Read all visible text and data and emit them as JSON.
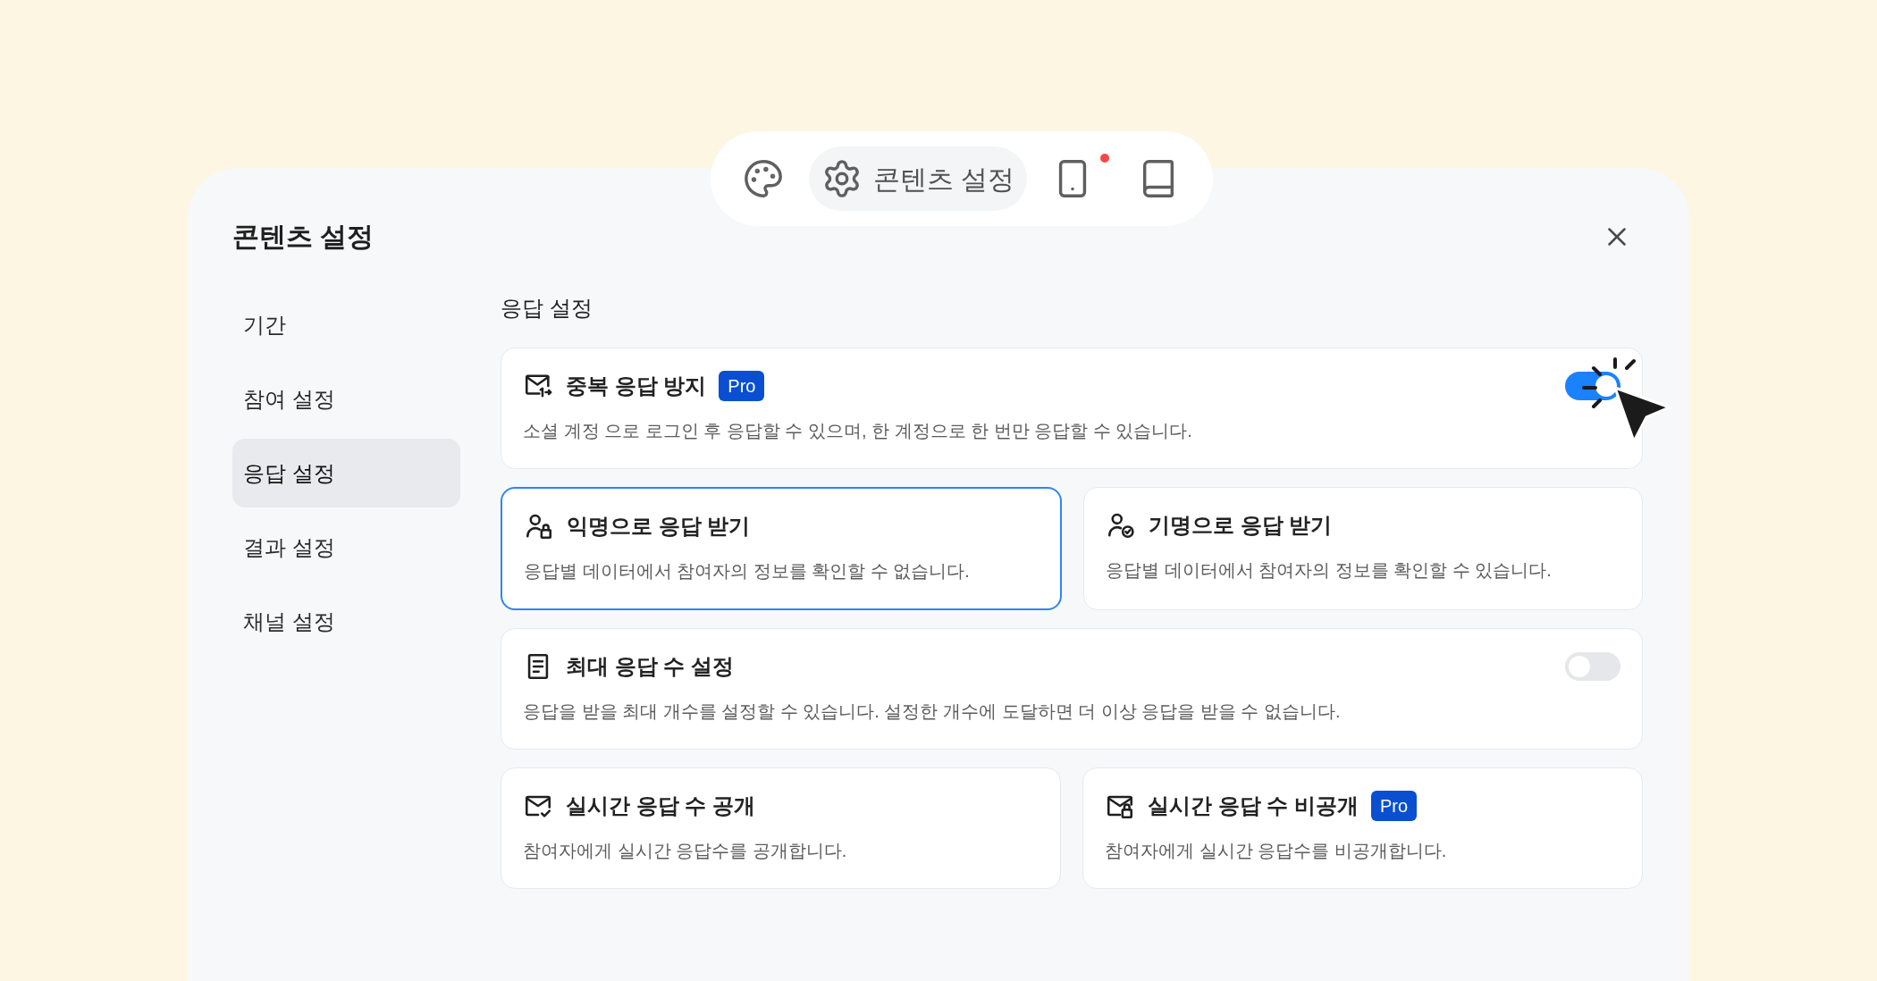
{
  "toolbar": {
    "items": [
      {
        "kind": "palette",
        "selected": false
      },
      {
        "kind": "settings",
        "label": "콘텐츠 설정",
        "selected": true
      },
      {
        "kind": "phone",
        "selected": false,
        "notification": true
      },
      {
        "kind": "book",
        "selected": false
      }
    ]
  },
  "panel": {
    "title": "콘텐츠 설정"
  },
  "sidebar": {
    "items": [
      {
        "label": "기간",
        "selected": false
      },
      {
        "label": "참여 설정",
        "selected": false
      },
      {
        "label": "응답 설정",
        "selected": true
      },
      {
        "label": "결과 설정",
        "selected": false
      },
      {
        "label": "채널 설정",
        "selected": false
      }
    ]
  },
  "section": {
    "title": "응답 설정",
    "rows": [
      {
        "cards": [
          {
            "kind": "mail-arrow",
            "title": "중복 응답 방지",
            "badge": "Pro",
            "description": "소셜 계정 으로 로그인 후 응답할 수 있으며, 한 계정으로 한 번만 응답할 수 있습니다.",
            "toggle": {
              "on": true
            }
          }
        ]
      },
      {
        "cards": [
          {
            "kind": "user-lock",
            "title": "익명으로 응답 받기",
            "description": "응답별 데이터에서 참여자의 정보를 확인할 수 없습니다.",
            "selected": true
          },
          {
            "kind": "user-check",
            "title": "기명으로 응답 받기",
            "description": "응답별 데이터에서 참여자의 정보를 확인할 수 있습니다.",
            "selected": false
          }
        ]
      },
      {
        "cards": [
          {
            "kind": "document",
            "title": "최대 응답 수 설정",
            "description": "응답을 받을 최대 개수를 설정할 수 있습니다. 설정한 개수에 도달하면 더 이상 응답을 받을 수 없습니다.",
            "toggle": {
              "on": false
            }
          }
        ]
      },
      {
        "cards": [
          {
            "kind": "mail-check",
            "title": "실시간 응답 수 공개",
            "description": "참여자에게 실시간 응답수를 공개합니다."
          },
          {
            "kind": "mail-lock",
            "title": "실시간 응답 수 비공개",
            "badge": "Pro",
            "description": "참여자에게 실시간 응답수를 비공개합니다."
          }
        ]
      }
    ]
  }
}
